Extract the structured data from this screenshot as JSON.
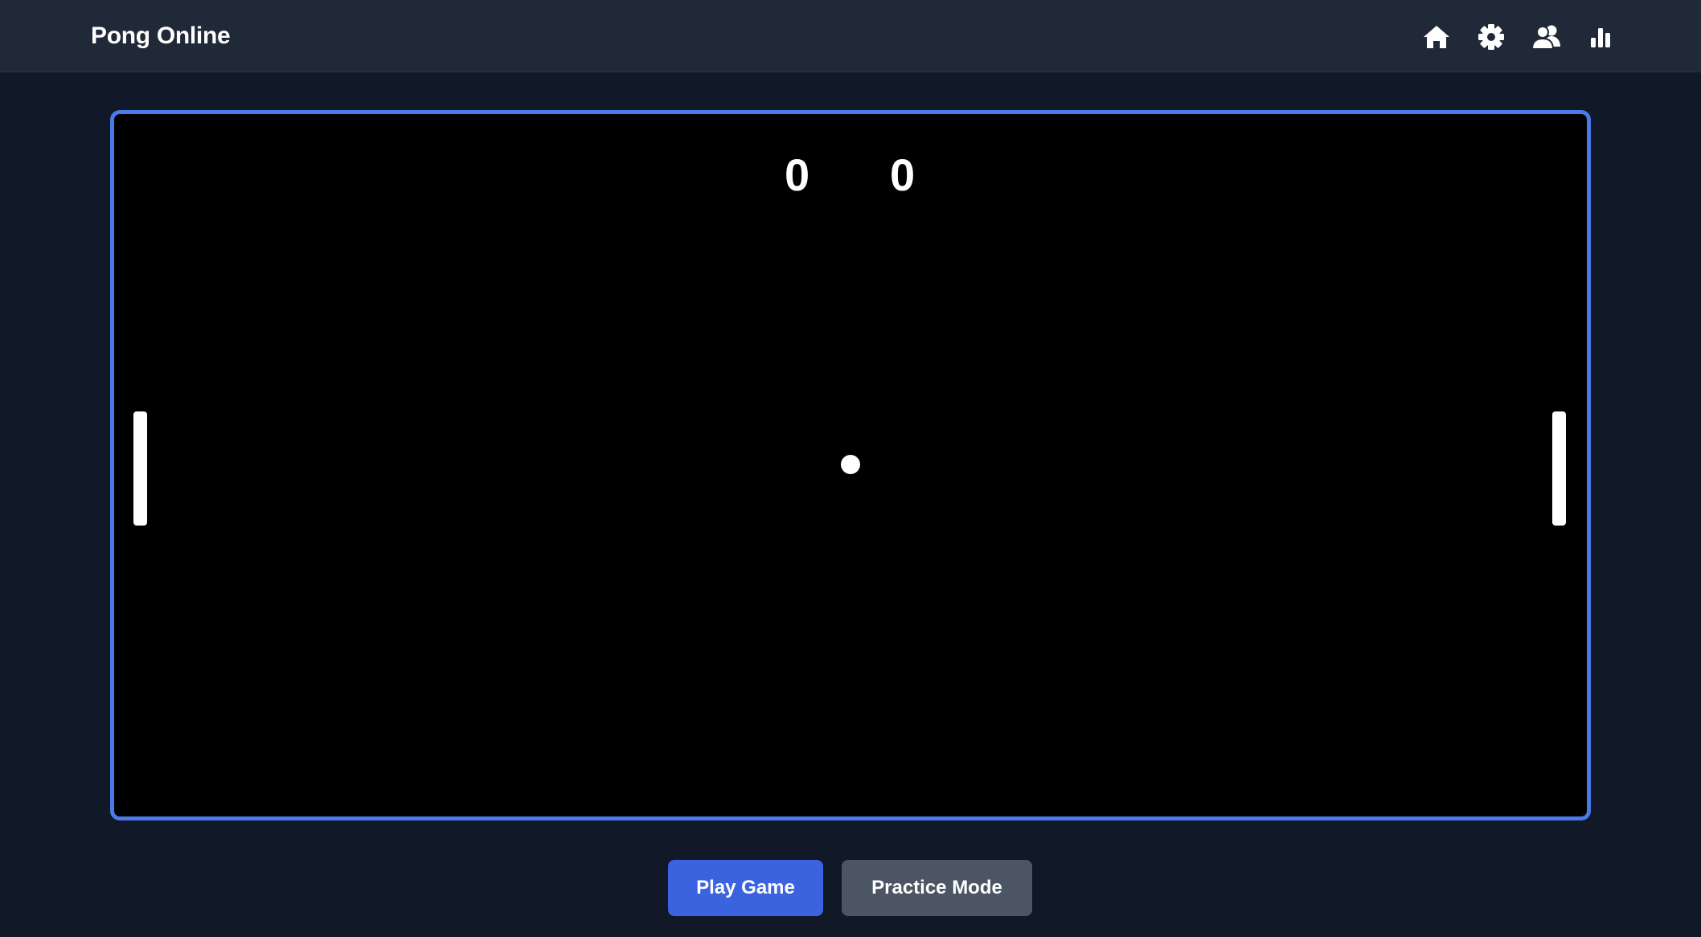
{
  "header": {
    "title": "Pong Online",
    "nav_icons": [
      "home-icon",
      "gear-icon",
      "users-icon",
      "bar-chart-icon"
    ]
  },
  "game": {
    "score_left": "0",
    "score_right": "0"
  },
  "actions": {
    "play_label": "Play Game",
    "practice_label": "Practice Mode"
  },
  "colors": {
    "page_bg": "#111827",
    "header_bg": "#1f2937",
    "frame_border": "#4a7ae8",
    "canvas_bg": "#000000",
    "play_button": "#3b63e0",
    "practice_button": "#4b5563"
  }
}
